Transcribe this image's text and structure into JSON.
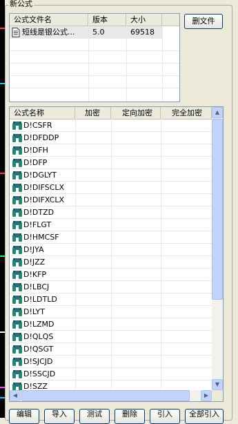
{
  "window": {
    "group_title": "新公式"
  },
  "file_list": {
    "columns": [
      "公式文件名",
      "版本",
      "大小"
    ],
    "rows": [
      {
        "name": "短线是银公式...",
        "version": "5.0",
        "size": "69518"
      }
    ]
  },
  "buttons": {
    "delete_file": "删文件",
    "bottom": [
      "编辑",
      "导入",
      "测试",
      "删除",
      "引入",
      "全部引入"
    ]
  },
  "formula_list": {
    "columns": [
      "公式名称",
      "加密",
      "定向加密",
      "完全加密"
    ],
    "items": [
      "D!CSFR",
      "D!DFDDP",
      "D!DFH",
      "D!DFP",
      "D!DGLYT",
      "D!DIFSCLX",
      "D!DIFXCLX",
      "D!DTZD",
      "D!FLGT",
      "D!HMCSF",
      "D!JYA",
      "D!JZZ",
      "D!KFP",
      "D!LBCJ",
      "D!LDTLD",
      "D!LYT",
      "D!LZMD",
      "D!QLQS",
      "D!QSGT",
      "D!SJCJD",
      "D!SSCJD",
      "D!SZZ"
    ]
  },
  "icons": {
    "formula": "binoculars-icon",
    "file": "document-icon"
  },
  "colors": {
    "selection": "#e8e8e8",
    "icon_green": "#1f8a6a",
    "border": "#7f9db9"
  }
}
